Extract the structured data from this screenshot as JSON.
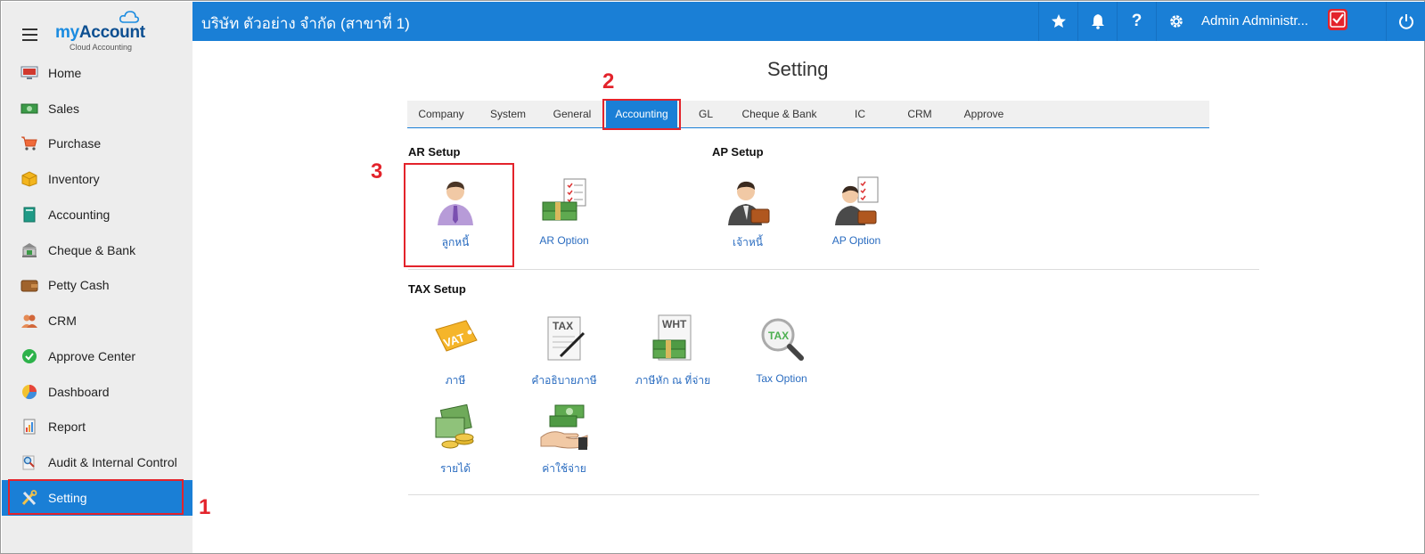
{
  "sidebar": {
    "logo": {
      "my": "my",
      "account": "Account",
      "tagline": "Cloud Accounting"
    },
    "items": [
      {
        "label": "Home",
        "icon": "home-monitor-icon"
      },
      {
        "label": "Sales",
        "icon": "cash-icon"
      },
      {
        "label": "Purchase",
        "icon": "cart-icon"
      },
      {
        "label": "Inventory",
        "icon": "box-icon"
      },
      {
        "label": "Accounting",
        "icon": "ledger-book-icon"
      },
      {
        "label": "Cheque & Bank",
        "icon": "bank-icon"
      },
      {
        "label": "Petty Cash",
        "icon": "wallet-icon"
      },
      {
        "label": "CRM",
        "icon": "people-icon"
      },
      {
        "label": "Approve Center",
        "icon": "check-circle-icon"
      },
      {
        "label": "Dashboard",
        "icon": "pie-chart-icon"
      },
      {
        "label": "Report",
        "icon": "report-icon"
      },
      {
        "label": "Audit & Internal Control",
        "icon": "magnifier-icon"
      },
      {
        "label": "Setting",
        "icon": "tools-icon",
        "active": true
      }
    ]
  },
  "header": {
    "company": "บริษัท ตัวอย่าง จำกัด (สาขาที่ 1)",
    "user": "Admin Administr...",
    "help_label": "?"
  },
  "main": {
    "title": "Setting",
    "tabs": [
      "Company",
      "System",
      "General",
      "Accounting",
      "GL",
      "Cheque & Bank",
      "IC",
      "CRM",
      "Approve"
    ],
    "active_tab": "Accounting",
    "ar_setup": {
      "title": "AR Setup",
      "items": [
        "ลูกหนี้",
        "AR Option"
      ]
    },
    "ap_setup": {
      "title": "AP Setup",
      "items": [
        "เจ้าหนี้",
        "AP Option"
      ]
    },
    "tax_setup": {
      "title": "TAX Setup",
      "items": [
        "ภาษี",
        "คำอธิบายภาษี",
        "ภาษีหัก ณ ที่จ่าย",
        "Tax Option",
        "รายได้",
        "ค่าใช้จ่าย"
      ]
    },
    "icon_labels": {
      "vat": "VAT",
      "tax": "TAX",
      "wht": "WHT"
    }
  },
  "annotations": [
    "1",
    "2",
    "3"
  ],
  "colors": {
    "brand_blue": "#1a7fd6",
    "highlight_red": "#e3232b",
    "link_blue": "#2a6cc0"
  }
}
